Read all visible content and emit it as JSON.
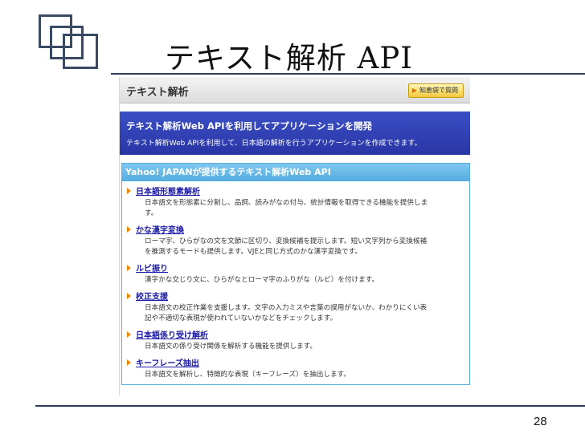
{
  "slide": {
    "title": "テキスト解析 API",
    "page_number": "28"
  },
  "screenshot": {
    "header_title": "テキスト解析",
    "ask_button": "知恵袋で質問",
    "banner": {
      "title": "テキスト解析Web APIを利用してアプリケーションを開発",
      "subtitle": "テキスト解析Web APIを利用して、日本語の解析を行うアプリケーションを作成できます。"
    },
    "section_title": "Yahoo! JAPANが提供するテキスト解析Web API",
    "items": [
      {
        "title": "日本語形態素解析",
        "desc": [
          "日本語文を形態素に分割し、品詞、読みがなの付与、統計情報を取得できる機能を提供しま",
          "す。"
        ]
      },
      {
        "title": "かな漢字変換",
        "desc": [
          "ローマ字、ひらがなの文を文節に区切り、変換候補を提示します。短い文字列から変換候補",
          "を推測するモードも提供します。VJEと同じ方式のかな漢字変換です。"
        ]
      },
      {
        "title": "ルビ振り",
        "desc": [
          "漢字かな交じり文に、ひらがなとローマ字のふりがな（ルビ）を付けます。"
        ]
      },
      {
        "title": "校正支援",
        "desc": [
          "日本語文の校正作業を支援します。文字の入力ミスや言葉の誤用がないか、わかりにくい表",
          "記や不適切な表現が使われていないかなどをチェックします。"
        ]
      },
      {
        "title": "日本語係り受け解析",
        "desc": [
          "日本語文の係り受け関係を解析する機能を提供します。"
        ]
      },
      {
        "title": "キーフレーズ抽出",
        "desc": [
          "日本語文を解析し、特徴的な表現（キーフレーズ）を抽出します。"
        ]
      }
    ]
  }
}
